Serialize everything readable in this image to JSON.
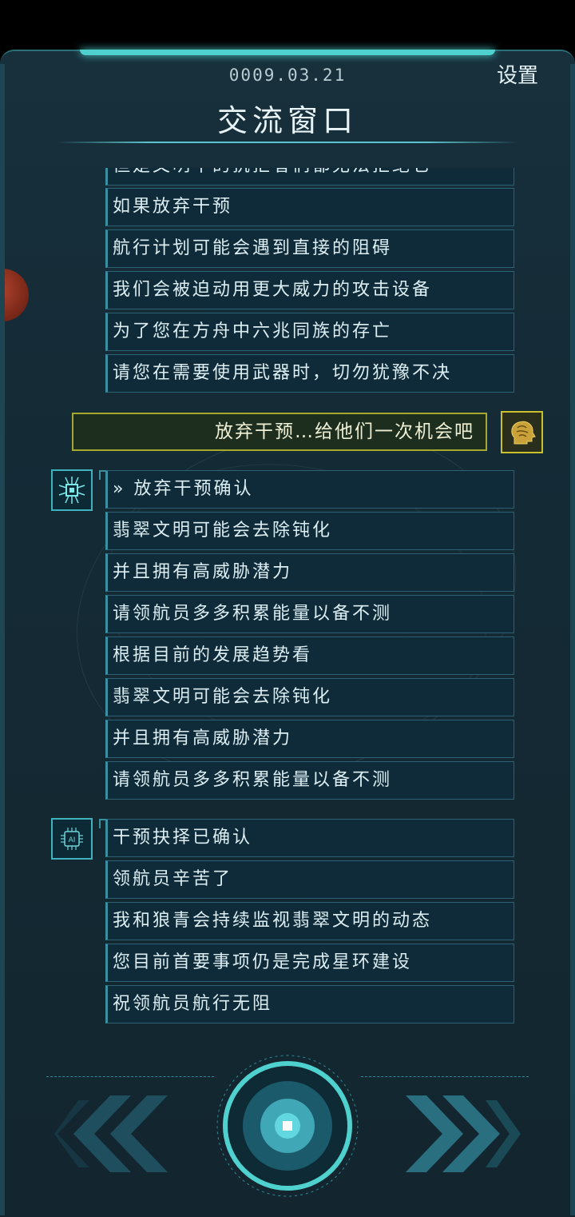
{
  "header": {
    "date": "0009.03.21",
    "settings_label": "设置",
    "title": "交流窗口"
  },
  "chat": {
    "partial_message": "但是文明中的抗拒者们都无法拒绝它",
    "group1": [
      "如果放弃干预",
      "航行计划可能会遇到直接的阻碍",
      "我们会被迫动用更大威力的攻击设备",
      "为了您在方舟中六兆同族的存亡",
      "请您在需要使用武器时，切勿犹豫不决"
    ],
    "user_message": "放弃干预…给他们一次机会吧",
    "group2": [
      "» 放弃干预确认",
      "翡翠文明可能会去除钝化",
      "并且拥有高威胁潜力",
      "请领航员多多积累能量以备不测",
      "根据目前的发展趋势看",
      "翡翠文明可能会去除钝化",
      "并且拥有高威胁潜力",
      "请领航员多多积累能量以备不测"
    ],
    "group3": [
      "干预抉择已确认",
      "领航员辛苦了",
      "我和狼青会持续监视翡翠文明的动态",
      "您目前首要事项仍是完成星环建设",
      "祝领航员航行无阻"
    ],
    "ai_chip_label": "AI"
  },
  "icons": {
    "circuit": "circuit-chip-icon",
    "ai_chip": "ai-chip-icon",
    "user": "brain-head-icon",
    "prev": "double-chevron-left-icon",
    "next": "double-chevron-right-icon",
    "center": "center-button-icon"
  },
  "colors": {
    "accent": "#4fd2cf",
    "user_border": "#a6a82f",
    "panel_bg": "#142a35"
  }
}
